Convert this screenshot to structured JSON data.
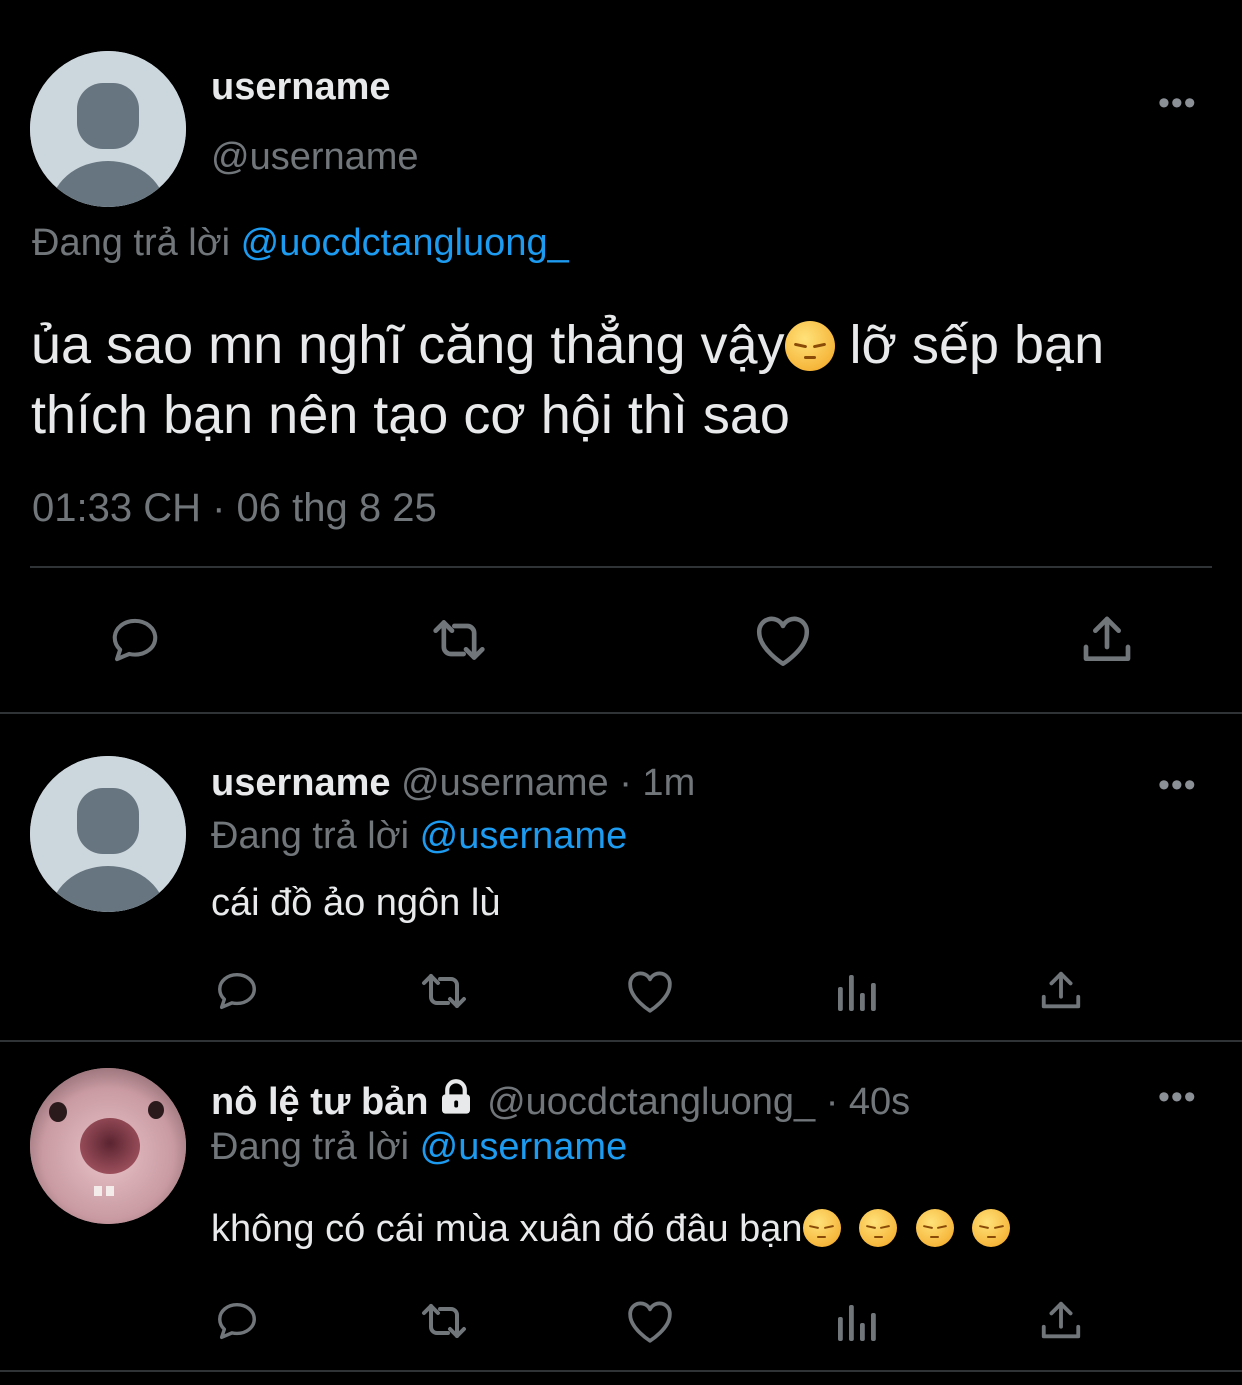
{
  "main_tweet": {
    "display_name": "username",
    "handle": "@username",
    "reply_prefix": "Đang trả lời",
    "reply_to": "@uocdctangluong_",
    "text_part1": "ủa sao mn nghĩ căng thẳng vậy",
    "text_part2": " lỡ sếp bạn",
    "text_line2": "thích bạn nên tạo cơ hội thì sao",
    "timestamp": "01:33 CH · 06 thg 8 25",
    "more": "•••"
  },
  "replies": [
    {
      "display_name": "username",
      "handle_time": "@username · 1m",
      "reply_prefix": "Đang trả lời",
      "reply_to": "@username",
      "text": "cái đồ ảo ngôn lù",
      "more": "•••"
    },
    {
      "display_name": "nô lệ tư bản",
      "handle_time": "@uocdctangluong_ · 40s",
      "reply_prefix": "Đang trả lời",
      "reply_to": "@username",
      "text": "không có cái mùa xuân đó đâu bạn",
      "more": "•••"
    }
  ],
  "icons": {
    "reply": "reply-icon",
    "retweet": "retweet-icon",
    "like": "heart-icon",
    "views": "views-icon",
    "share": "share-icon",
    "lock": "lock-icon",
    "emoji": "pensive-face-emoji"
  },
  "colors": {
    "background": "#000000",
    "text": "#e7e9ea",
    "muted": "#71767b",
    "link": "#1d9bf0",
    "divider": "#2f3336"
  }
}
